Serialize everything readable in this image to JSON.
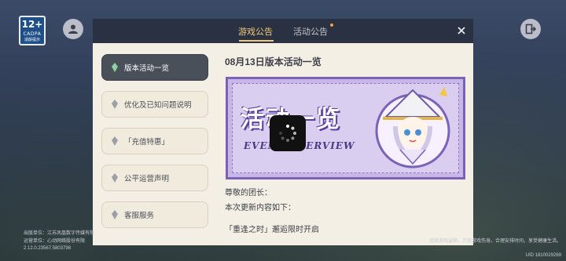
{
  "age_badge": {
    "rating": "12+",
    "label": "CADPA",
    "sub": "适龄提示"
  },
  "tabs": [
    {
      "label": "游戏公告",
      "active": true
    },
    {
      "label": "活动公告",
      "active": false
    }
  ],
  "sidebar": {
    "items": [
      {
        "label": "版本活动一览",
        "active": true
      },
      {
        "label": "优化及已知问题说明",
        "active": false
      },
      {
        "label": "「充值特惠」",
        "active": false
      },
      {
        "label": "公平运营声明",
        "active": false
      },
      {
        "label": "客服服务",
        "active": false
      }
    ]
  },
  "content": {
    "title": "08月13日版本活动一览",
    "banner_title": "活动一览",
    "banner_subtitle": "EVENT OVERVIEW",
    "lines": [
      "尊敬的团长：",
      "本次更新内容如下：",
      "「重逢之时」邂逅限时开启"
    ]
  },
  "footer": {
    "publisher": "出版单位：江苏凤凰数字传媒有限",
    "operator": "运营单位：心动网络股份有限",
    "version": "2.12.0.23567.5803798",
    "uid": "UID 1810029269",
    "right_notice": "适度游戏益脑，沉迷游戏伤身。合理安排时间，享受健康生活。"
  },
  "colors": {
    "accent": "#f3c978",
    "active_item": "#4a505a",
    "panel_bg": "#f4efe5",
    "header_bg": "#2a3143",
    "banner_purple": "#7a62b8"
  }
}
